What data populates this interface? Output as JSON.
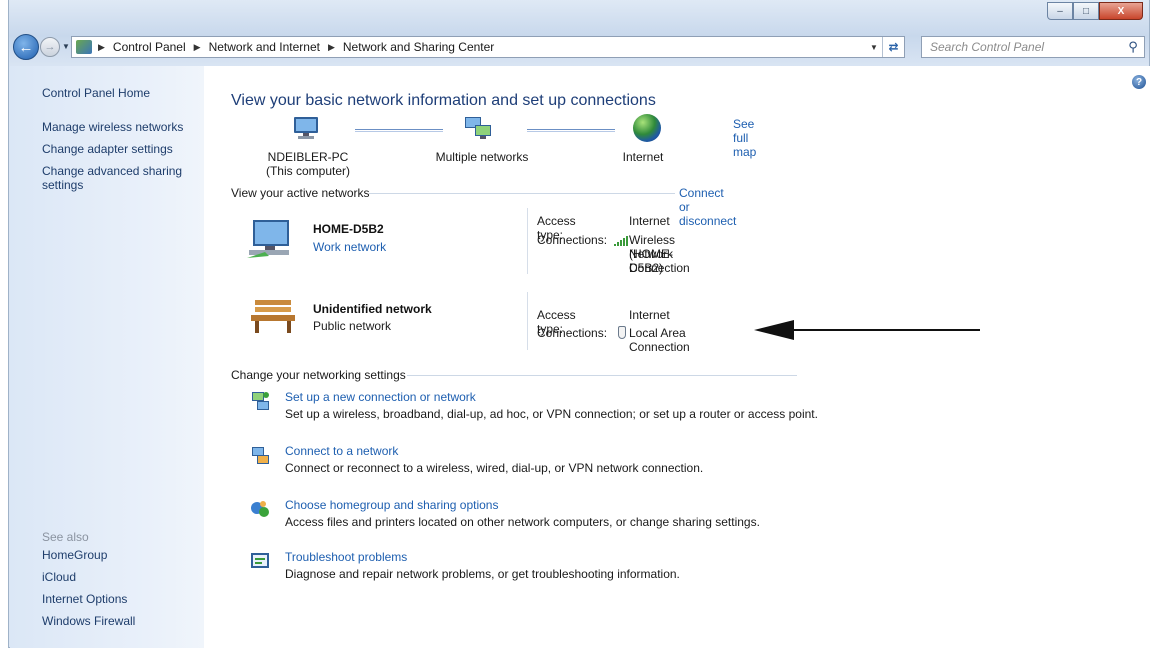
{
  "window": {
    "caption_buttons": {
      "minimize": "–",
      "maximize": "□",
      "close": "X"
    }
  },
  "navigation": {
    "back_icon": "back-arrow-icon",
    "forward_icon": "forward-arrow-icon",
    "breadcrumbs": [
      "Control Panel",
      "Network and Internet",
      "Network and Sharing Center"
    ],
    "search_placeholder": "Search Control Panel"
  },
  "sidebar": {
    "home": "Control Panel Home",
    "links": [
      "Manage wireless networks",
      "Change adapter settings",
      "Change advanced sharing settings"
    ],
    "see_also_label": "See also",
    "see_also_links": [
      "HomeGroup",
      "iCloud",
      "Internet Options",
      "Windows Firewall"
    ]
  },
  "main": {
    "title": "View your basic network information and set up connections",
    "see_full_map": "See full map",
    "map": {
      "computer_name": "NDEIBLER-PC",
      "computer_sub": "(This computer)",
      "middle": "Multiple networks",
      "internet": "Internet"
    },
    "active_networks": {
      "heading": "View your active networks",
      "action": "Connect or disconnect",
      "networks": [
        {
          "name": "HOME-D5B2",
          "type": "Work network",
          "type_is_link": true,
          "access_label": "Access type:",
          "access_value": "Internet",
          "connections_label": "Connections:",
          "connection_line1": "Wireless Network Connection",
          "connection_line2": "(HOME-D5B2)",
          "connection_icon": "wifi-signal-icon"
        },
        {
          "name": "Unidentified network",
          "type": "Public network",
          "type_is_link": false,
          "access_label": "Access type:",
          "access_value": "Internet",
          "connections_label": "Connections:",
          "connection_line1": "Local Area Connection",
          "connection_icon": "ethernet-plug-icon"
        }
      ]
    },
    "settings": {
      "heading": "Change your networking settings",
      "tasks": [
        {
          "title": "Set up a new connection or network",
          "desc": "Set up a wireless, broadband, dial-up, ad hoc, or VPN connection; or set up a router or access point.",
          "icon": "new-connection-icon"
        },
        {
          "title": "Connect to a network",
          "desc": "Connect or reconnect to a wireless, wired, dial-up, or VPN network connection.",
          "icon": "connect-network-icon"
        },
        {
          "title": "Choose homegroup and sharing options",
          "desc": "Access files and printers located on other network computers, or change sharing settings.",
          "icon": "homegroup-icon"
        },
        {
          "title": "Troubleshoot problems",
          "desc": "Diagnose and repair network problems, or get troubleshooting information.",
          "icon": "troubleshoot-icon"
        }
      ]
    }
  },
  "colors": {
    "link": "#1e5fb0",
    "title": "#1e3e78",
    "sidebar_bg": "#dbe7f6"
  }
}
